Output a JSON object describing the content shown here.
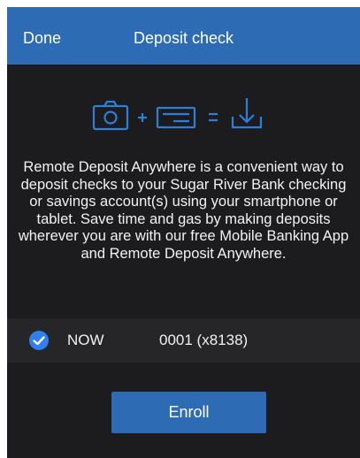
{
  "nav": {
    "done_label": "Done",
    "title": "Deposit check"
  },
  "hero": {
    "icons": [
      "camera-icon",
      "plus-icon",
      "check-card-icon",
      "equals-icon",
      "download-icon"
    ],
    "accent_color": "#2f7fd8"
  },
  "description": "Remote Deposit Anywhere is a convenient way to deposit checks to your Sugar River Bank checking or savings account(s) using your smartphone or tablet. Save time and gas by making deposits wherever you are with our free Mobile Banking App and Remote Deposit Anywhere.",
  "accounts": [
    {
      "name": "NOW",
      "number": "0001 (x8138)",
      "selected": true
    }
  ],
  "enroll_label": "Enroll",
  "colors": {
    "nav_background": "#2d6bb5",
    "screen_background": "#1c1c1e",
    "row_background": "#262628",
    "check_color": "#2f80ed",
    "button_background": "#2d6bb5"
  }
}
